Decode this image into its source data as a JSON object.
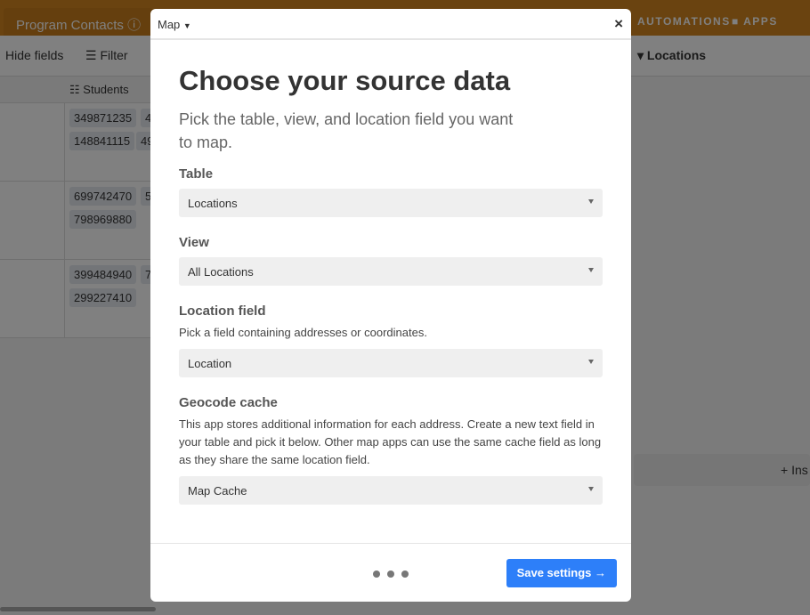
{
  "background": {
    "base_tab": "Program Contacts",
    "nav": [
      "AUTOMATIONS",
      "APPS"
    ],
    "toolbar": {
      "hide_fields": "Hide fields",
      "filter": "Filter",
      "locations": "Locations"
    },
    "column_header": "Students",
    "rows": [
      [
        "349871235",
        "4",
        "148841115",
        "49"
      ],
      [
        "699742470",
        "5",
        "798969880"
      ],
      [
        "399484940",
        "7",
        "299227410"
      ]
    ],
    "insert_label": "+ Ins"
  },
  "modal": {
    "app_name": "Map",
    "close": "×",
    "title": "Choose your source data",
    "subtitle": "Pick the table, view, and location field you want to map.",
    "fields": [
      {
        "label": "Table",
        "value": "Locations"
      },
      {
        "label": "View",
        "value": "All Locations"
      },
      {
        "label": "Location field",
        "hint": "Pick a field containing addresses or coordinates.",
        "value": "Location"
      },
      {
        "label": "Geocode cache",
        "hint": "This app stores additional information for each address. Create a new text field in your table and pick it below. Other map apps can use the same cache field as long as they share the same location field.",
        "value": "Map Cache"
      }
    ],
    "save_label": "Save settings →",
    "pager_steps": 3,
    "accent": "#2d7ff9"
  }
}
